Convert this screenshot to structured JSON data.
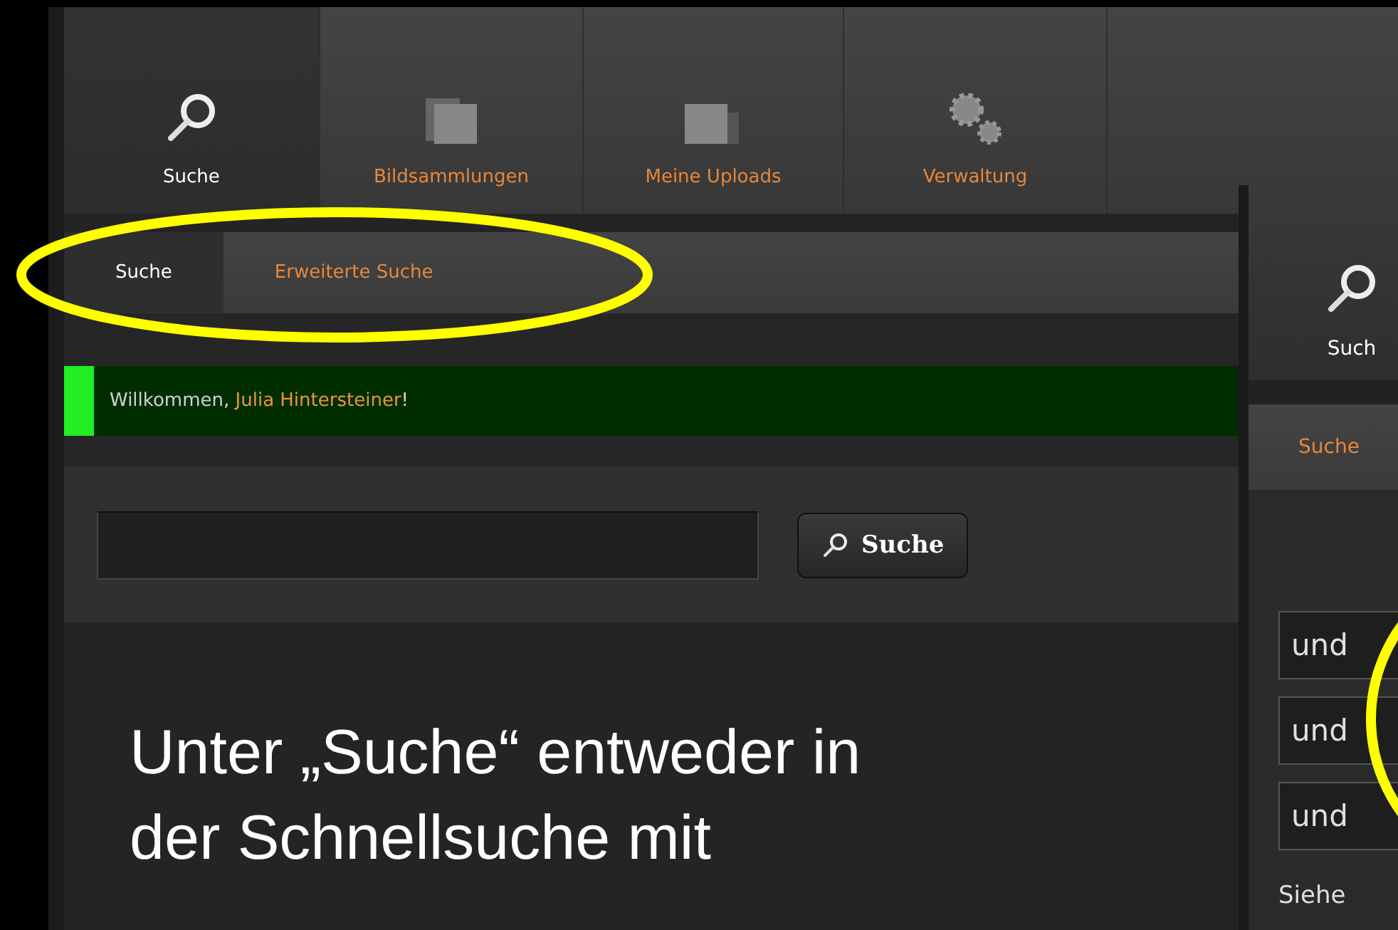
{
  "left_window": {
    "nav_tabs": [
      {
        "label": "Suche",
        "kind": "search",
        "selected": true
      },
      {
        "label": "Bildsammlungen",
        "kind": "folder",
        "selected": false
      },
      {
        "label": "Meine Uploads",
        "kind": "uploads",
        "selected": false
      },
      {
        "label": "Verwaltung",
        "kind": "gears",
        "selected": false
      }
    ],
    "sub_tabs": [
      {
        "label": "Suche",
        "selected": true
      },
      {
        "label": "Erweiterte Suche",
        "selected": false
      }
    ],
    "welcome": {
      "text": "Willkommen, ",
      "name": "Julia Hintersteiner",
      "suffix": "!"
    },
    "search": {
      "button": "Suche"
    }
  },
  "right_window": {
    "nav_tab": {
      "label": "Such",
      "kind": "search",
      "selected": true
    },
    "sub_tab": {
      "label": "Suche",
      "selected": false
    },
    "operators": [
      "und",
      "und",
      "und"
    ],
    "footer_link": "Siehe"
  },
  "caption": [
    "Unter „Suche“ entweder in",
    "der Schnellsuche mit"
  ]
}
